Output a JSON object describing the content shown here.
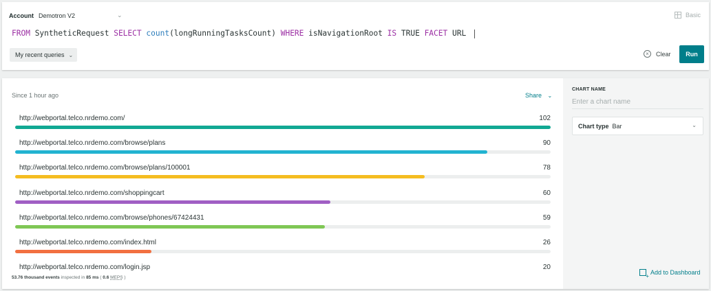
{
  "account": {
    "label": "Account",
    "value": "Demotron V2"
  },
  "mode_toggle": "Basic",
  "query": {
    "tokens": [
      {
        "text": "FROM",
        "cls": "kw"
      },
      {
        "text": " SyntheticRequest ",
        "cls": ""
      },
      {
        "text": "SELECT",
        "cls": "kw"
      },
      {
        "text": " ",
        "cls": ""
      },
      {
        "text": "count",
        "cls": "fn"
      },
      {
        "text": "(longRunningTasksCount) ",
        "cls": ""
      },
      {
        "text": "WHERE",
        "cls": "kw"
      },
      {
        "text": " isNavigationRoot ",
        "cls": ""
      },
      {
        "text": "IS",
        "cls": "kw"
      },
      {
        "text": " TRUE ",
        "cls": ""
      },
      {
        "text": "FACET",
        "cls": "kw"
      },
      {
        "text": " URL",
        "cls": ""
      }
    ]
  },
  "recent_queries_label": "My recent queries",
  "clear_label": "Clear",
  "run_label": "Run",
  "results": {
    "since": "Since 1 hour ago",
    "share_label": "Share",
    "footer": {
      "events": "53.76 thousand events",
      "inspected_in": "inspected in",
      "ms": "85 ms",
      "meps_value": "0.6",
      "meps_label": "MEPS"
    }
  },
  "chart_data": {
    "type": "bar",
    "orientation": "horizontal",
    "max": 102,
    "categories": [
      "http://webportal.telco.nrdemo.com/",
      "http://webportal.telco.nrdemo.com/browse/plans",
      "http://webportal.telco.nrdemo.com/browse/plans/100001",
      "http://webportal.telco.nrdemo.com/shoppingcart",
      "http://webportal.telco.nrdemo.com/browse/phones/67424431",
      "http://webportal.telco.nrdemo.com/index.html",
      "http://webportal.telco.nrdemo.com/login.jsp"
    ],
    "values": [
      102,
      90,
      78,
      60,
      59,
      26,
      20
    ],
    "colors": [
      "#11a893",
      "#22b3d1",
      "#f5bd21",
      "#a05fc4",
      "#7fc755",
      "#f27041",
      "#2e6ab5"
    ]
  },
  "sidebar": {
    "chart_name_label": "CHART NAME",
    "chart_name_placeholder": "Enter a chart name",
    "chart_type_label": "Chart type",
    "chart_type_value": "Bar",
    "add_dashboard_label": "Add to Dashboard"
  }
}
